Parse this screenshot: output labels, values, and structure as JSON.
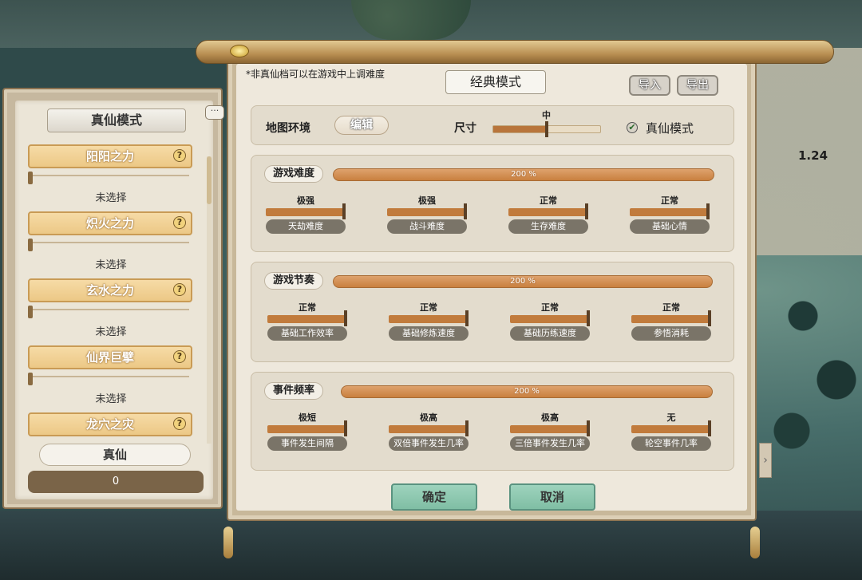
{
  "version": "1.24",
  "left_panel": {
    "title": "真仙模式",
    "powers": [
      {
        "name": "阳阳之力",
        "state": "未选择"
      },
      {
        "name": "炽火之力",
        "state": "未选择"
      },
      {
        "name": "玄水之力",
        "state": "未选择"
      },
      {
        "name": "仙界巨擘",
        "state": "未选择"
      },
      {
        "name": "龙穴之灾",
        "state": ""
      }
    ],
    "zhenxian_label": "真仙",
    "zhenxian_value": "0"
  },
  "main": {
    "note": "*非真仙档可以在游戏中上调难度",
    "mode_title": "经典模式",
    "import_label": "导入",
    "export_label": "导出",
    "map": {
      "label": "地图环境",
      "edit_label": "编辑",
      "size_label": "尺寸",
      "size_value": "中",
      "size_fraction": 0.5,
      "real_mode_label": "真仙模式",
      "real_mode_checked": true
    },
    "difficulty": {
      "title": "游戏难度",
      "percent_label": "200 %",
      "items": [
        {
          "level": "极强",
          "name": "天劫难度",
          "fraction": 1.0
        },
        {
          "level": "极强",
          "name": "战斗难度",
          "fraction": 1.0
        },
        {
          "level": "正常",
          "name": "生存难度",
          "fraction": 1.0
        },
        {
          "level": "正常",
          "name": "基础心情",
          "fraction": 1.0
        }
      ]
    },
    "pace": {
      "title": "游戏节奏",
      "percent_label": "200 %",
      "items": [
        {
          "level": "正常",
          "name": "基础工作效率",
          "fraction": 1.0
        },
        {
          "level": "正常",
          "name": "基础修炼速度",
          "fraction": 1.0
        },
        {
          "level": "正常",
          "name": "基础历练速度",
          "fraction": 1.0
        },
        {
          "level": "正常",
          "name": "参悟消耗",
          "fraction": 1.0
        }
      ]
    },
    "events": {
      "title": "事件频率",
      "percent_label": "200 %",
      "items": [
        {
          "level": "极短",
          "name": "事件发生间隔",
          "fraction": 1.0
        },
        {
          "level": "极高",
          "name": "双倍事件发生几率",
          "fraction": 1.0
        },
        {
          "level": "极高",
          "name": "三倍事件发生几率",
          "fraction": 1.0
        },
        {
          "level": "无",
          "name": "轮空事件几率",
          "fraction": 1.0
        }
      ]
    },
    "ok_label": "确定",
    "cancel_label": "取消"
  }
}
